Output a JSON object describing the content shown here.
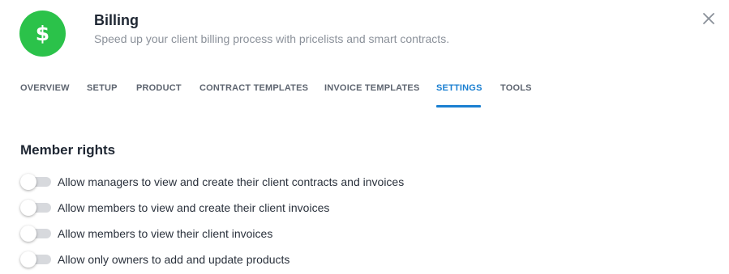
{
  "header": {
    "app_icon_glyph": "$",
    "app_icon_color": "#2bc24a",
    "title": "Billing",
    "subtitle": "Speed up your client billing process with pricelists and smart contracts.",
    "close_icon": "close-icon"
  },
  "tabs": [
    {
      "label": "OVERVIEW",
      "active": false
    },
    {
      "label": "SETUP",
      "active": false
    },
    {
      "label": "PRODUCT",
      "active": false
    },
    {
      "label": "CONTRACT TEMPLATES",
      "active": false
    },
    {
      "label": "INVOICE TEMPLATES",
      "active": false
    },
    {
      "label": "SETTINGS",
      "active": true
    },
    {
      "label": "TOOLS",
      "active": false
    }
  ],
  "accent_color": "#1a7fd1",
  "member_rights": {
    "title": "Member rights",
    "settings": [
      {
        "label": "Allow managers to view and create their client contracts and invoices",
        "enabled": false
      },
      {
        "label": "Allow members to view and create their client invoices",
        "enabled": false
      },
      {
        "label": "Allow members to view their client invoices",
        "enabled": false
      },
      {
        "label": "Allow only owners to add and update products",
        "enabled": false
      }
    ]
  }
}
